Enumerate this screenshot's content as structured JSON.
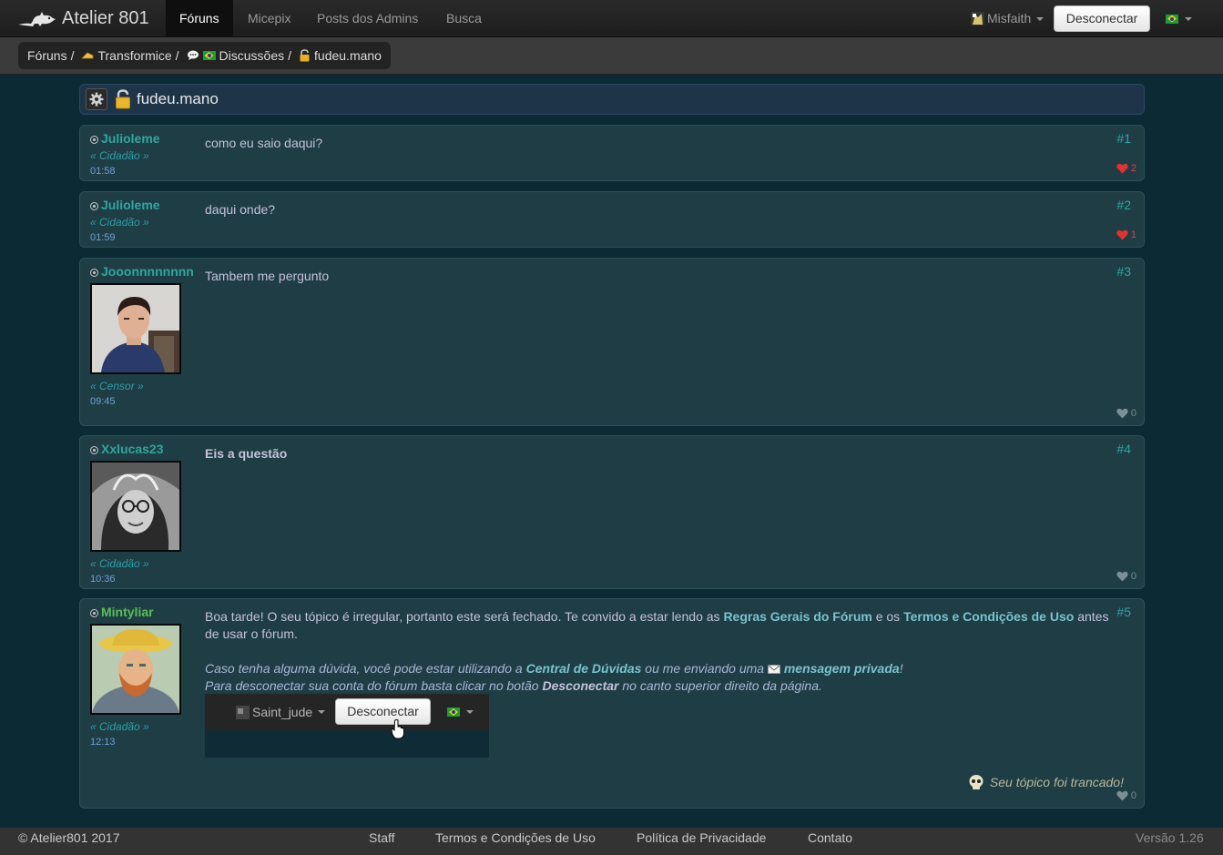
{
  "navbar": {
    "brand": "Atelier 801",
    "items": [
      {
        "label": "Fóruns",
        "active": true
      },
      {
        "label": "Micepix",
        "active": false
      },
      {
        "label": "Posts dos Admins",
        "active": false
      },
      {
        "label": "Busca",
        "active": false
      }
    ],
    "user": "Misfaith",
    "disconnect": "Desconectar",
    "language_flag": "brazil-flag-icon"
  },
  "breadcrumb": {
    "forums": "Fóruns",
    "section": "Transformice",
    "subsection": "Discussões",
    "topic": "fudeu.mano",
    "separator": "/"
  },
  "topic": {
    "title": "fudeu.mano"
  },
  "posts": [
    {
      "author": "Julioleme",
      "role": "« Cidadão »",
      "time": "01:58",
      "number": "#1",
      "body": "como eu saio daqui?",
      "likes": "2"
    },
    {
      "author": "Julioleme",
      "role": "« Cidadão »",
      "time": "01:59",
      "number": "#2",
      "body": "daqui onde?",
      "likes": "1"
    },
    {
      "author": "Jooonnnnnnnn",
      "role": "« Censor »",
      "time": "09:45",
      "number": "#3",
      "body": "Tambem me pergunto",
      "likes": "0"
    },
    {
      "author": "Xxlucas23",
      "role": "« Cidadão »",
      "time": "10:36",
      "number": "#4",
      "body": "Eis a questão",
      "likes": "0"
    },
    {
      "author": "Mintyliar",
      "role": "« Cidadão »",
      "time": "12:13",
      "number": "#5",
      "likes": "0",
      "p1_a": "Boa tarde! O seu tópico é irregular, portanto este será fechado. Te convido a estar lendo as",
      "p1_link1": "Regras Gerais do Fórum",
      "p1_b": "e os",
      "p1_link2": "Termos e Condições de Uso",
      "p1_c": "antes de usar o fórum.",
      "p2_a": "Caso tenha alguma dúvida, você pode estar utilizando a",
      "p2_link1": "Central de Dúvidas",
      "p2_b": "ou me enviando uma",
      "p2_link2": "mensagem privada",
      "p2_c": "!",
      "p3_a": "Para desconectar sua conta do fórum basta clicar no botão",
      "p3_bold": "Desconectar",
      "p3_b": "no canto superior direito da página.",
      "embed_user": "Saint_jude",
      "embed_button": "Desconectar",
      "locked_note": "Seu tópico foi trancado!"
    }
  ],
  "footer": {
    "copyright": "© Atelier801 2017",
    "links": [
      "Staff",
      "Termos e Condições de Uso",
      "Política de Privacidade",
      "Contato"
    ],
    "version": "Versão 1.26"
  },
  "colors": {
    "background": "#0c2a33",
    "post_bg": "#1f3d45",
    "author": "#2ea7a0",
    "mod_author": "#56c056",
    "like_heart": "#d84242"
  }
}
